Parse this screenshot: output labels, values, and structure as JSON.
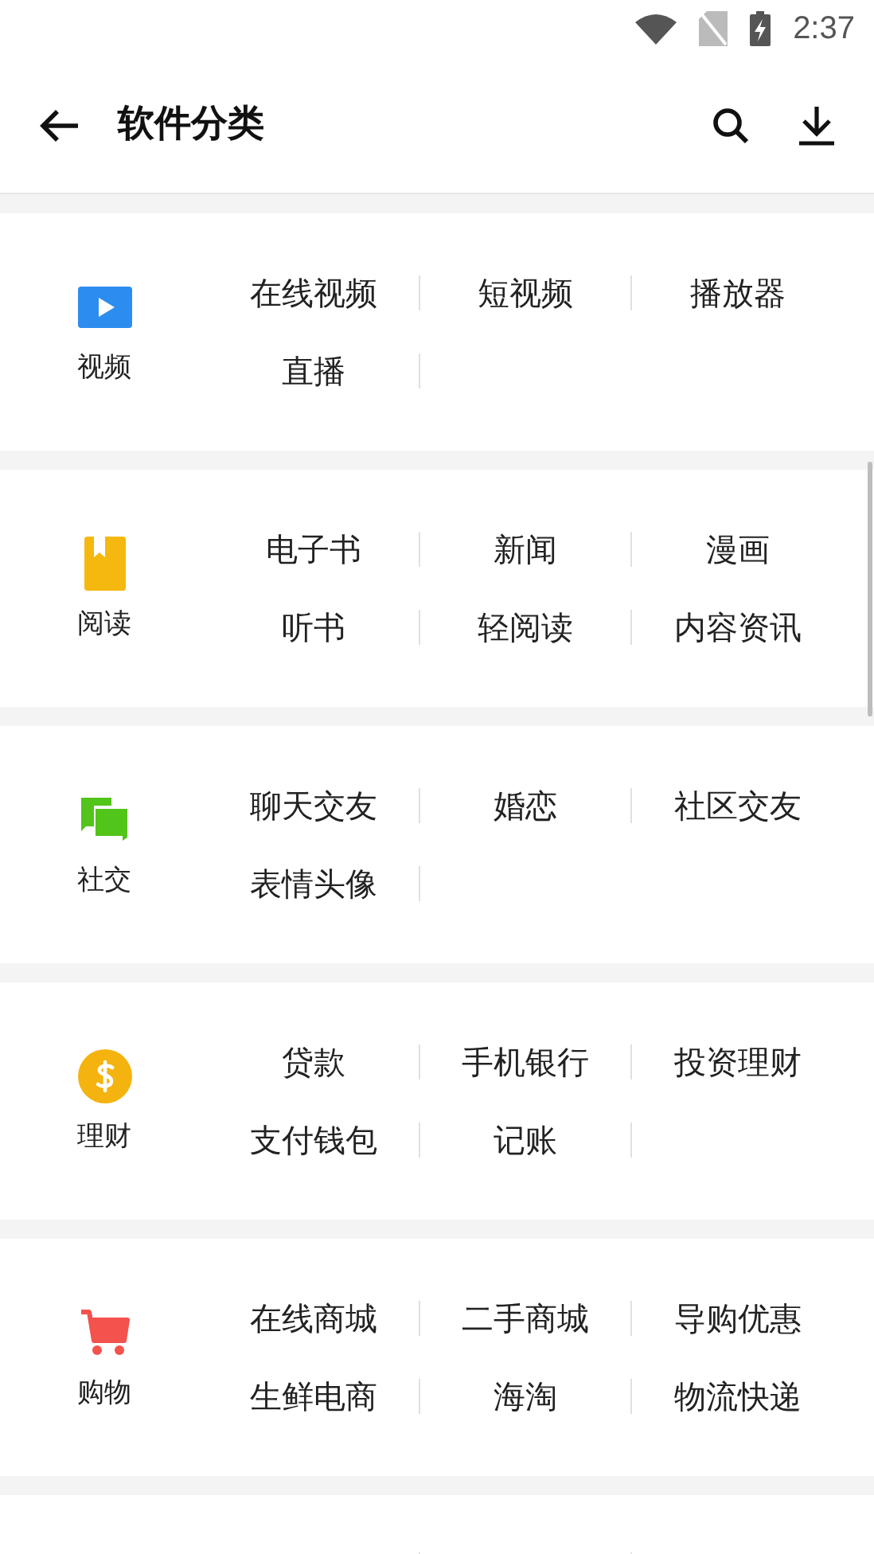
{
  "status_bar": {
    "time": "2:37"
  },
  "header": {
    "title": "软件分类"
  },
  "categories": [
    {
      "name": "视频",
      "items": [
        "在线视频",
        "短视频",
        "播放器",
        "直播"
      ]
    },
    {
      "name": "阅读",
      "items": [
        "电子书",
        "新闻",
        "漫画",
        "听书",
        "轻阅读",
        "内容资讯"
      ]
    },
    {
      "name": "社交",
      "items": [
        "聊天交友",
        "婚恋",
        "社区交友",
        "表情头像"
      ]
    },
    {
      "name": "理财",
      "items": [
        "贷款",
        "手机银行",
        "投资理财",
        "支付钱包",
        "记账"
      ]
    },
    {
      "name": "购物",
      "items": [
        "在线商城",
        "二手商城",
        "导购优惠",
        "生鲜电商",
        "海淘",
        "物流快递"
      ]
    }
  ]
}
